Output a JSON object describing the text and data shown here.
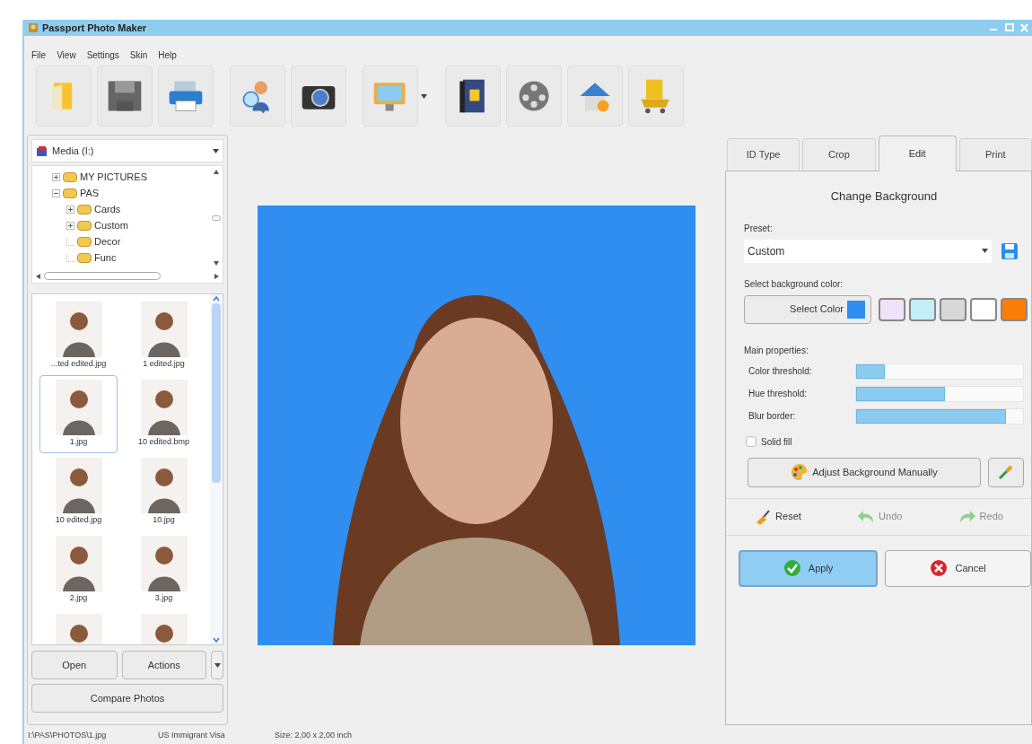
{
  "window": {
    "title": "Passport Photo Maker"
  },
  "menu": [
    "File",
    "View",
    "Settings",
    "Skin",
    "Help"
  ],
  "toolbar": [
    [
      {
        "kind": "open",
        "dropdown": false
      },
      {
        "kind": "save",
        "dropdown": false
      },
      {
        "kind": "print",
        "dropdown": false
      }
    ],
    [
      {
        "kind": "find",
        "dropdown": false
      },
      {
        "kind": "camera",
        "dropdown": false
      }
    ],
    [
      {
        "kind": "monitor",
        "dropdown": true
      }
    ],
    [
      {
        "kind": "book",
        "dropdown": false
      },
      {
        "kind": "film",
        "dropdown": false
      },
      {
        "kind": "home",
        "dropdown": false
      },
      {
        "kind": "cart",
        "dropdown": false
      }
    ]
  ],
  "drive": "Media (I:)",
  "tree": [
    {
      "label": "MY PICTURES",
      "expandable": true,
      "expanded": false
    },
    {
      "label": "PAS",
      "expandable": true,
      "expanded": true,
      "children": [
        {
          "label": "Cards",
          "expandable": true,
          "expanded": false
        },
        {
          "label": "Custom",
          "expandable": true,
          "expanded": false
        },
        {
          "label": "Decor",
          "expandable": false
        },
        {
          "label": "Func",
          "expandable": false
        }
      ]
    }
  ],
  "thumbnails": [
    {
      "label": "...ted edited.jpg",
      "selected": false
    },
    {
      "label": "1 edited.jpg",
      "selected": false
    },
    {
      "label": "1.jpg",
      "selected": true
    },
    {
      "label": "10 edited.bmp",
      "selected": false
    },
    {
      "label": "10 edited.jpg",
      "selected": false
    },
    {
      "label": "10.jpg",
      "selected": false
    },
    {
      "label": "2.jpg",
      "selected": false
    },
    {
      "label": "3.jpg",
      "selected": false
    },
    {
      "selected": false
    },
    {
      "selected": false
    }
  ],
  "left_buttons": {
    "open": "Open",
    "actions": "Actions",
    "compare": "Compare Photos"
  },
  "tabs": [
    {
      "label": "ID Type",
      "selected": false
    },
    {
      "label": "Crop",
      "selected": false
    },
    {
      "label": "Edit",
      "selected": true
    },
    {
      "label": "Print",
      "selected": false
    }
  ],
  "panel": {
    "title": "Change Background",
    "preset_label": "Preset:",
    "preset_value": "Custom",
    "color_label": "Select background color:",
    "select_color": {
      "label": "Select Color",
      "color": "#2f8ef0"
    },
    "swatches": [
      {
        "color": "#f0e2f8"
      },
      {
        "color": "#c4eef8"
      },
      {
        "color": "#d8d8d8"
      },
      {
        "color": "#ffffff"
      },
      {
        "color": "#f97d08"
      }
    ],
    "properties_label": "Main properties:",
    "sliders": [
      {
        "label": "Color threshold:",
        "level": 0.17
      },
      {
        "label": "Hue threshold:",
        "level": 0.53
      },
      {
        "label": "Blur border:",
        "level": 0.9
      }
    ],
    "solid_fill": {
      "label": "Solid fill",
      "checked": false
    },
    "adjust_button": "Adjust Background Manually",
    "history": [
      {
        "kind": "reset",
        "label": "Reset",
        "disabled": false
      },
      {
        "kind": "undo",
        "label": "Undo",
        "disabled": true
      },
      {
        "kind": "redo",
        "label": "Redo",
        "disabled": true
      }
    ],
    "apply": "Apply",
    "cancel": "Cancel"
  },
  "status_bar": [
    "I:\\PAS\\PHOTOS\\1.jpg",
    "US Immigrant Visa",
    "Size: 2,00 x 2,00 inch"
  ]
}
